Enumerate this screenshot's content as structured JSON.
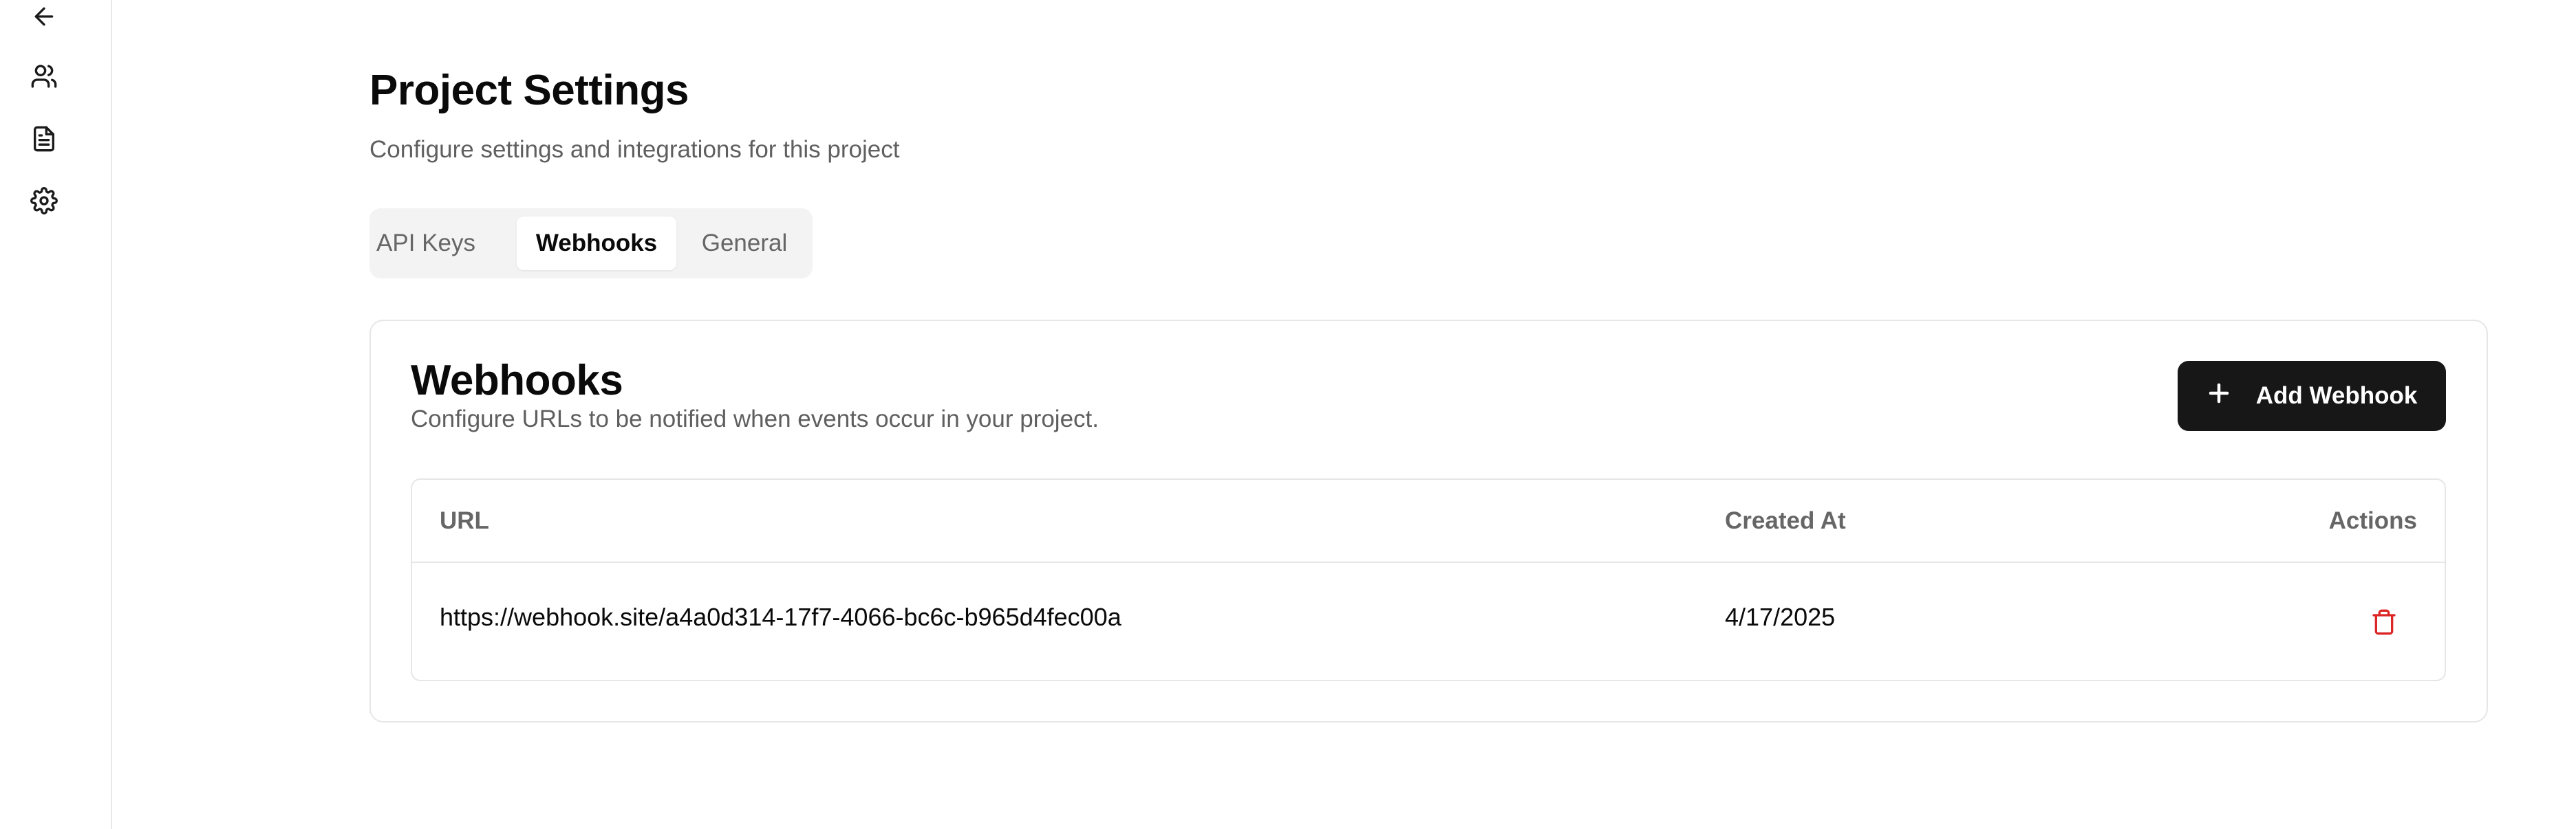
{
  "sidebar": {
    "items": [
      {
        "icon": "arrow-left-icon"
      },
      {
        "icon": "users-icon"
      },
      {
        "icon": "document-icon"
      },
      {
        "icon": "gear-icon"
      }
    ]
  },
  "header": {
    "title": "Project Settings",
    "subtitle": "Configure settings and integrations for this project"
  },
  "tabs": [
    {
      "label": "API Keys",
      "active": false
    },
    {
      "label": "Webhooks",
      "active": true
    },
    {
      "label": "General",
      "active": false
    }
  ],
  "webhooks": {
    "title": "Webhooks",
    "description": "Configure URLs to be notified when events occur in your project.",
    "add_button_label": "Add Webhook",
    "table": {
      "columns": [
        "URL",
        "Created At",
        "Actions"
      ],
      "rows": [
        {
          "url": "https://webhook.site/a4a0d314-17f7-4066-bc6c-b965d4fec00a",
          "created_at": "4/17/2025",
          "action_icon": "trash-icon"
        }
      ]
    }
  },
  "colors": {
    "primary_button": "#171717",
    "danger": "#dc2626",
    "muted_text": "#5f5f5f",
    "border": "#e6e6e6"
  }
}
